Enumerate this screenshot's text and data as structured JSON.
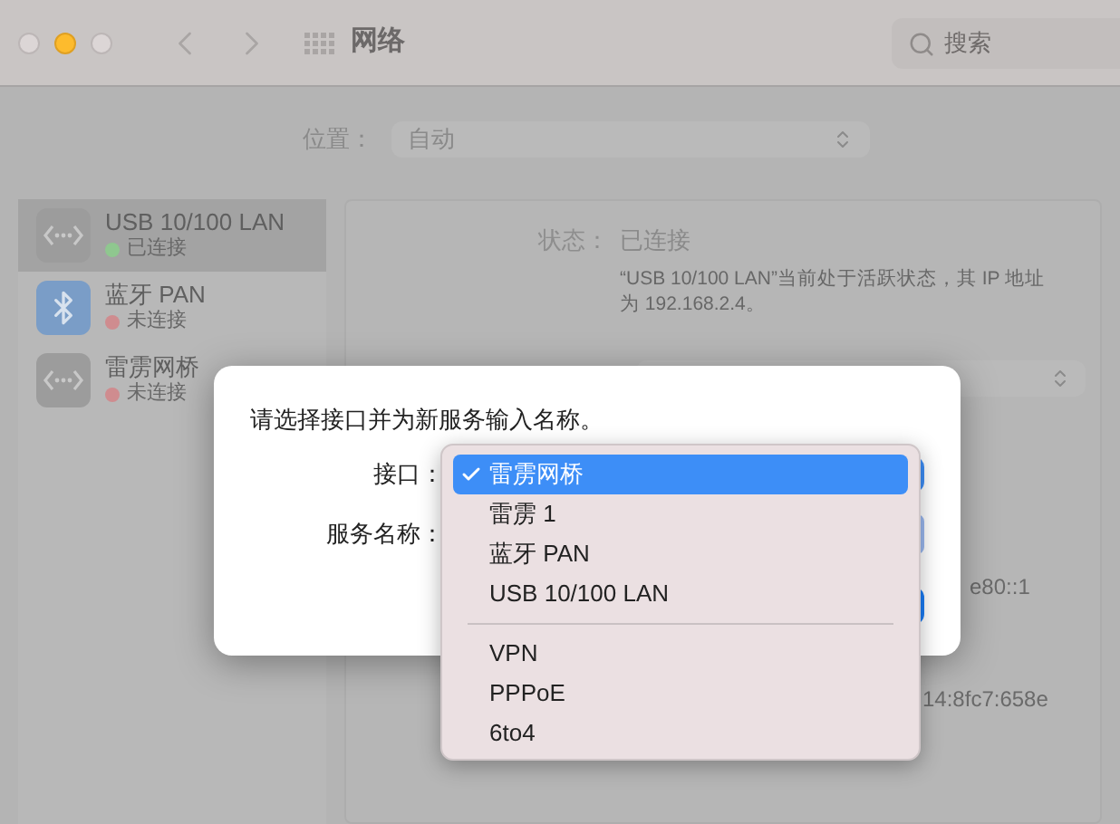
{
  "window": {
    "title": "网络",
    "search": {
      "placeholder": "搜索"
    }
  },
  "location": {
    "label": "位置：",
    "value": "自动"
  },
  "services": [
    {
      "name": "USB 10/100 LAN",
      "status": "已连接",
      "connected": true,
      "selected": true,
      "kind": "ethernet"
    },
    {
      "name": "蓝牙 PAN",
      "status": "未连接",
      "connected": false,
      "selected": false,
      "kind": "bluetooth"
    },
    {
      "name": "雷雳网桥",
      "status": "未连接",
      "connected": false,
      "selected": false,
      "kind": "ethernet"
    }
  ],
  "detail": {
    "status_label": "状态：",
    "status_value": "已连接",
    "description": "“USB 10/100 LAN”当前处于活跃状态，其 IP 地址为 192.168.2.4。",
    "fragments": [
      "e80::1",
      "14:8fc7:658e"
    ]
  },
  "dialog": {
    "prompt": "请选择接口并为新服务输入名称。",
    "fields": [
      {
        "label": "接口："
      },
      {
        "label": "服务名称："
      }
    ]
  },
  "menu": {
    "items": [
      {
        "kind": "item",
        "label": "雷雳网桥",
        "selected": true
      },
      {
        "kind": "item",
        "label": "雷雳 1",
        "selected": false
      },
      {
        "kind": "item",
        "label": "蓝牙 PAN",
        "selected": false
      },
      {
        "kind": "item",
        "label": "USB 10/100 LAN",
        "selected": false
      },
      {
        "kind": "separator"
      },
      {
        "kind": "item",
        "label": "VPN",
        "selected": false
      },
      {
        "kind": "item",
        "label": "PPPoE",
        "selected": false
      },
      {
        "kind": "item",
        "label": "6to4",
        "selected": false
      }
    ]
  }
}
